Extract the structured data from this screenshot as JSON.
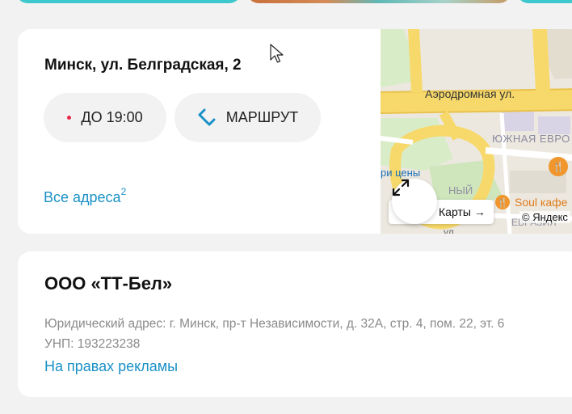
{
  "colors": {
    "background": "#f2f2f3",
    "card": "#ffffff",
    "accent_link": "#1a91c6",
    "hours_dot": "#e8284b",
    "route_icon": "#1a91c6",
    "teal_card": "#3cc8cc"
  },
  "address_card": {
    "address": "Минск, ул. Белградская, 2",
    "hours_label": "ДО 19:00",
    "route_label": "МАРШРУТ",
    "route_icon": "route-icon",
    "all_addresses_label": "Все адреса",
    "all_addresses_count": "2"
  },
  "map": {
    "street_label": "Аэродромная ул.",
    "district_label": "ЮЖНАЯ ЕВРО",
    "prices_label": "ри цены",
    "ny_label": "НЫЙ",
    "poi_label": "Soul кафе",
    "eurasia_label": "ЕВРАЗИЯ",
    "ul_label": "ул.",
    "maps_link_label": "Карты →",
    "copyright": "© Яндекс",
    "expand_icon": "expand-icon"
  },
  "company_card": {
    "name": "ООО «ТТ-Бел»",
    "legal_address": "Юридический адрес: г. Минск, пр-т Независимости, д. 32А, стр. 4, пом. 22, эт. 6",
    "unp": "УНП: 193223238",
    "ad_link": "На правах рекламы"
  }
}
